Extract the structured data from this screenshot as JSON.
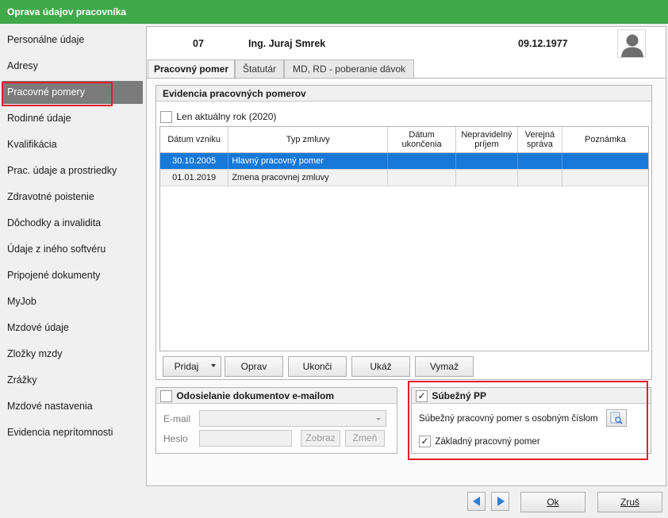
{
  "window": {
    "title": "Oprava údajov pracovníka"
  },
  "sidebar": {
    "items": [
      {
        "label": "Personálne údaje"
      },
      {
        "label": "Adresy"
      },
      {
        "label": "Pracovné pomery"
      },
      {
        "label": "Rodinné údaje"
      },
      {
        "label": "Kvalifikácia"
      },
      {
        "label": "Prac. údaje a prostriedky"
      },
      {
        "label": "Zdravotné poistenie"
      },
      {
        "label": "Dôchodky a invalidita"
      },
      {
        "label": "Údaje z iného softvéru"
      },
      {
        "label": "Pripojené dokumenty"
      },
      {
        "label": "MyJob"
      },
      {
        "label": "Mzdové údaje"
      },
      {
        "label": "Zložky mzdy"
      },
      {
        "label": "Zrážky"
      },
      {
        "label": "Mzdové nastavenia"
      },
      {
        "label": "Evidencia neprítomnosti"
      }
    ],
    "active_index": 2
  },
  "header": {
    "number": "07",
    "name": "Ing. Juraj Smrek",
    "birth_date": "09.12.1977"
  },
  "tabs": [
    {
      "label": "Pracovný pomer"
    },
    {
      "label": "Štatutár"
    },
    {
      "label": "MD, RD - poberanie dávok"
    }
  ],
  "employment": {
    "title": "Evidencia pracovných pomerov",
    "current_year_label": "Len aktuálny rok (2020)",
    "current_year_checked": false,
    "columns": [
      "Dátum vzniku",
      "Typ zmluvy",
      "Dátum ukončenia",
      "Nepravidelný príjem",
      "Verejná správa",
      "Poznámka"
    ],
    "rows": [
      {
        "start": "30.10.2005",
        "type": "Hlavný pracovný pomer",
        "end": "",
        "irregular": "",
        "public": "",
        "note": ""
      },
      {
        "start": "01.01.2019",
        "type": "Zmena pracovnej zmluvy",
        "end": "",
        "irregular": "",
        "public": "",
        "note": ""
      }
    ],
    "buttons": {
      "add": "Pridaj",
      "edit": "Oprav",
      "finish": "Ukonči",
      "show": "Ukáž",
      "delete": "Vymaž"
    }
  },
  "email_sending": {
    "title": "Odosielanie dokumentov e-mailom",
    "checked": false,
    "email_label": "E-mail",
    "email_value": "",
    "password_label": "Heslo",
    "password_value": "",
    "show_button": "Zobraz",
    "change_button": "Zmeň"
  },
  "concurrent": {
    "title": "Súbežný PP",
    "checked": true,
    "with_number_label": "Súbežný pracovný pomer s osobným číslom",
    "basic_label": "Základný pracovný pomer",
    "basic_checked": true
  },
  "footer": {
    "ok": "Ok",
    "cancel": "Zruš"
  },
  "colors": {
    "title_bar": "#3fa84a",
    "selection": "#1979d9",
    "active_sidebar": "#7b7b7b",
    "highlight": "#e0202a"
  }
}
